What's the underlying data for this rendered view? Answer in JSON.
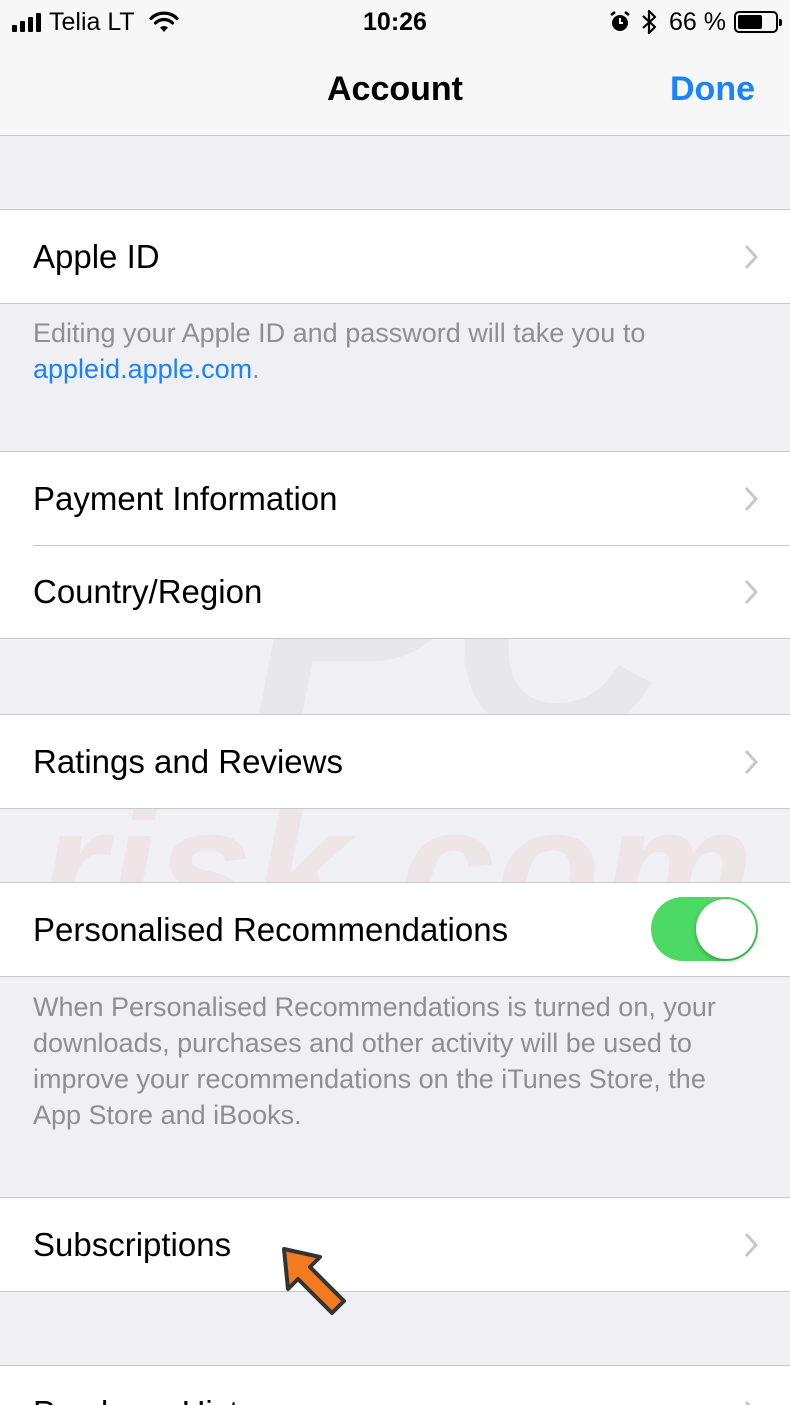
{
  "status_bar": {
    "carrier": "Telia LT",
    "time": "10:26",
    "battery_percent": "66 %",
    "battery_level": 0.66,
    "icons": [
      "signal-icon",
      "wifi-icon",
      "alarm-icon",
      "bluetooth-icon",
      "battery-icon"
    ]
  },
  "nav": {
    "title": "Account",
    "done_label": "Done",
    "accent_color": "#1a82fb"
  },
  "groups": {
    "apple_id": {
      "label": "Apple ID",
      "footer_text": "Editing your Apple ID and password will take you to",
      "footer_link": "appleid.apple.com",
      "footer_end": "."
    },
    "payment": {
      "payment_label": "Payment Information",
      "country_label": "Country/Region"
    },
    "ratings": {
      "label": "Ratings and Reviews"
    },
    "recommendations": {
      "label": "Personalised Recommendations",
      "toggle_on": true,
      "toggle_color": "#4cd964",
      "footer_text": "When Personalised Recommendations is turned on, your downloads, purchases and other activity will be used to improve your recommendations on the iTunes Store, the App Store and iBooks."
    },
    "subscriptions": {
      "label": "Subscriptions"
    },
    "purchase_history": {
      "label": "Purchase History"
    }
  },
  "watermark": {
    "text_top": "PC",
    "text_bottom": "risk.com"
  },
  "annotation_color": "#f47a20"
}
